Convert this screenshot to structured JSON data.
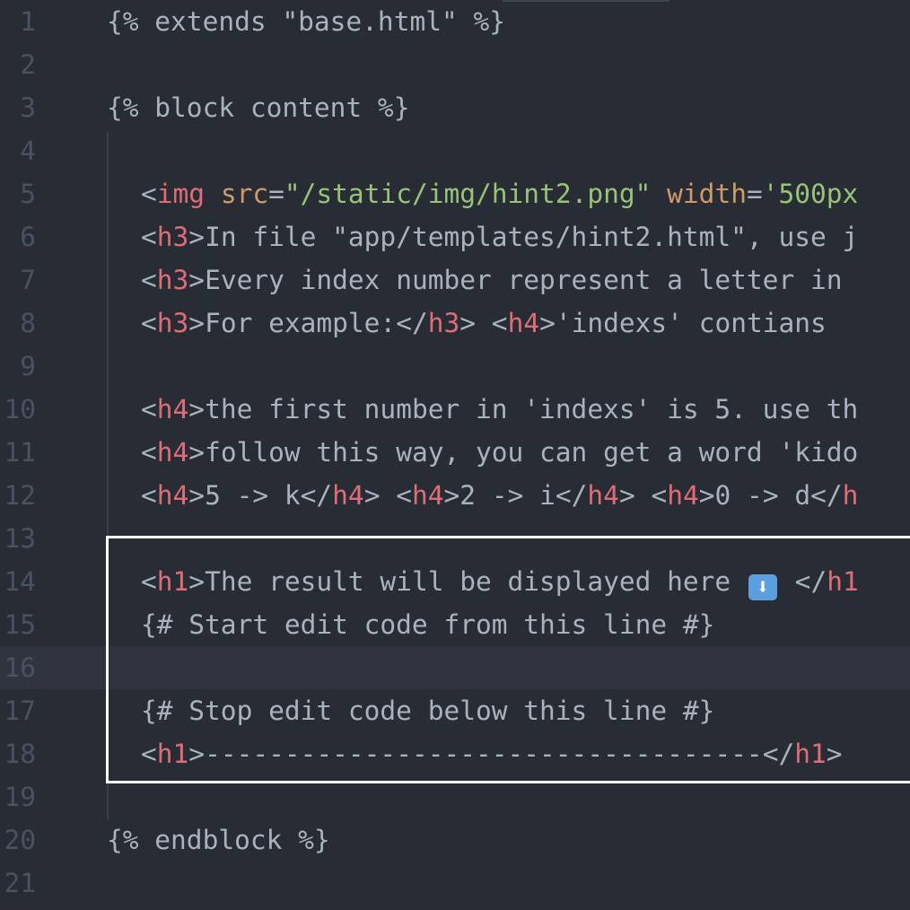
{
  "editor": {
    "lines": [
      {
        "num": "1",
        "tokens": [
          {
            "t": "{% extends \"base.html\" %}",
            "c": "tpl"
          }
        ]
      },
      {
        "num": "2",
        "tokens": []
      },
      {
        "num": "3",
        "tokens": [
          {
            "t": "{% block content %}",
            "c": "tpl"
          }
        ]
      },
      {
        "num": "4",
        "tokens": []
      },
      {
        "num": "5",
        "indent": true,
        "tokens": [
          {
            "t": "<",
            "c": "punct"
          },
          {
            "t": "img",
            "c": "tag"
          },
          {
            "t": " ",
            "c": "text"
          },
          {
            "t": "src",
            "c": "attr"
          },
          {
            "t": "=",
            "c": "punct"
          },
          {
            "t": "\"/static/img/hint2.png\"",
            "c": "str"
          },
          {
            "t": " ",
            "c": "text"
          },
          {
            "t": "width",
            "c": "attr"
          },
          {
            "t": "=",
            "c": "punct"
          },
          {
            "t": "'500px",
            "c": "str"
          }
        ]
      },
      {
        "num": "6",
        "indent": true,
        "tokens": [
          {
            "t": "<",
            "c": "punct"
          },
          {
            "t": "h3",
            "c": "tag"
          },
          {
            "t": ">",
            "c": "punct"
          },
          {
            "t": "In file \"app/templates/hint2.html\", use j",
            "c": "text"
          }
        ]
      },
      {
        "num": "7",
        "indent": true,
        "tokens": [
          {
            "t": "<",
            "c": "punct"
          },
          {
            "t": "h3",
            "c": "tag"
          },
          {
            "t": ">",
            "c": "punct"
          },
          {
            "t": "Every index number represent a letter in ",
            "c": "text"
          }
        ]
      },
      {
        "num": "8",
        "indent": true,
        "tokens": [
          {
            "t": "<",
            "c": "punct"
          },
          {
            "t": "h3",
            "c": "tag"
          },
          {
            "t": ">",
            "c": "punct"
          },
          {
            "t": "For example:",
            "c": "text"
          },
          {
            "t": "</",
            "c": "punct"
          },
          {
            "t": "h3",
            "c": "tag"
          },
          {
            "t": ">",
            "c": "punct"
          },
          {
            "t": " ",
            "c": "text"
          },
          {
            "t": "<",
            "c": "punct"
          },
          {
            "t": "h4",
            "c": "tag"
          },
          {
            "t": ">",
            "c": "punct"
          },
          {
            "t": "'indexs' contians ",
            "c": "text"
          }
        ]
      },
      {
        "num": "9",
        "tokens": []
      },
      {
        "num": "10",
        "indent": true,
        "tokens": [
          {
            "t": "<",
            "c": "punct"
          },
          {
            "t": "h4",
            "c": "tag"
          },
          {
            "t": ">",
            "c": "punct"
          },
          {
            "t": "the first number in 'indexs' is 5. use th",
            "c": "text"
          }
        ]
      },
      {
        "num": "11",
        "indent": true,
        "tokens": [
          {
            "t": "<",
            "c": "punct"
          },
          {
            "t": "h4",
            "c": "tag"
          },
          {
            "t": ">",
            "c": "punct"
          },
          {
            "t": "follow this way, you can get a word 'kido",
            "c": "text"
          }
        ]
      },
      {
        "num": "12",
        "indent": true,
        "tokens": [
          {
            "t": "<",
            "c": "punct"
          },
          {
            "t": "h4",
            "c": "tag"
          },
          {
            "t": ">",
            "c": "punct"
          },
          {
            "t": "5 -> k",
            "c": "text"
          },
          {
            "t": "</",
            "c": "punct"
          },
          {
            "t": "h4",
            "c": "tag"
          },
          {
            "t": ">",
            "c": "punct"
          },
          {
            "t": " ",
            "c": "text"
          },
          {
            "t": "<",
            "c": "punct"
          },
          {
            "t": "h4",
            "c": "tag"
          },
          {
            "t": ">",
            "c": "punct"
          },
          {
            "t": "2 -> i",
            "c": "text"
          },
          {
            "t": "</",
            "c": "punct"
          },
          {
            "t": "h4",
            "c": "tag"
          },
          {
            "t": ">",
            "c": "punct"
          },
          {
            "t": " ",
            "c": "text"
          },
          {
            "t": "<",
            "c": "punct"
          },
          {
            "t": "h4",
            "c": "tag"
          },
          {
            "t": ">",
            "c": "punct"
          },
          {
            "t": "0 -> d",
            "c": "text"
          },
          {
            "t": "</",
            "c": "punct"
          },
          {
            "t": "h",
            "c": "tag"
          }
        ]
      },
      {
        "num": "13",
        "tokens": []
      },
      {
        "num": "14",
        "indent": true,
        "tokens": [
          {
            "t": "<",
            "c": "punct"
          },
          {
            "t": "h1",
            "c": "tag"
          },
          {
            "t": ">",
            "c": "punct"
          },
          {
            "t": "The result will be displayed here ",
            "c": "text"
          },
          {
            "t": "⬇",
            "c": "emoji"
          },
          {
            "t": " </",
            "c": "punct"
          },
          {
            "t": "h1",
            "c": "tag"
          }
        ]
      },
      {
        "num": "15",
        "indent": true,
        "tokens": [
          {
            "t": "{# Start edit code from this line #}",
            "c": "comment"
          }
        ]
      },
      {
        "num": "16",
        "cursor": true,
        "tokens": []
      },
      {
        "num": "17",
        "indent": true,
        "tokens": [
          {
            "t": "{# Stop edit code below this line #}",
            "c": "comment"
          }
        ]
      },
      {
        "num": "18",
        "indent": true,
        "tokens": [
          {
            "t": "<",
            "c": "punct"
          },
          {
            "t": "h1",
            "c": "tag"
          },
          {
            "t": ">",
            "c": "punct"
          },
          {
            "t": "-----------------------------------",
            "c": "text"
          },
          {
            "t": "</",
            "c": "punct"
          },
          {
            "t": "h1",
            "c": "tag"
          },
          {
            "t": ">",
            "c": "punct"
          }
        ]
      },
      {
        "num": "19",
        "tokens": []
      },
      {
        "num": "20",
        "tokens": [
          {
            "t": "{% endblock %}",
            "c": "tpl"
          }
        ]
      },
      {
        "num": "21",
        "tokens": []
      }
    ]
  },
  "colors": {
    "background": "#282c34",
    "gutter": "#495162",
    "tag": "#e06c75",
    "attribute": "#d19a66",
    "string": "#98c379",
    "text": "#abb2bf",
    "highlight_border": "#ffffff"
  }
}
